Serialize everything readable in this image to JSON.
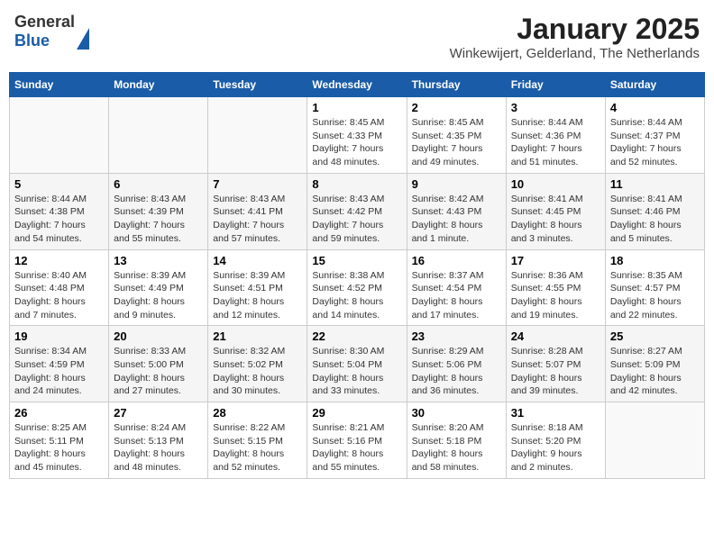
{
  "header": {
    "logo": {
      "line1": "General",
      "line2": "Blue"
    },
    "title": "January 2025",
    "subtitle": "Winkewijert, Gelderland, The Netherlands"
  },
  "days_of_week": [
    "Sunday",
    "Monday",
    "Tuesday",
    "Wednesday",
    "Thursday",
    "Friday",
    "Saturday"
  ],
  "weeks": [
    [
      {
        "day": "",
        "info": ""
      },
      {
        "day": "",
        "info": ""
      },
      {
        "day": "",
        "info": ""
      },
      {
        "day": "1",
        "info": "Sunrise: 8:45 AM\nSunset: 4:33 PM\nDaylight: 7 hours\nand 48 minutes."
      },
      {
        "day": "2",
        "info": "Sunrise: 8:45 AM\nSunset: 4:35 PM\nDaylight: 7 hours\nand 49 minutes."
      },
      {
        "day": "3",
        "info": "Sunrise: 8:44 AM\nSunset: 4:36 PM\nDaylight: 7 hours\nand 51 minutes."
      },
      {
        "day": "4",
        "info": "Sunrise: 8:44 AM\nSunset: 4:37 PM\nDaylight: 7 hours\nand 52 minutes."
      }
    ],
    [
      {
        "day": "5",
        "info": "Sunrise: 8:44 AM\nSunset: 4:38 PM\nDaylight: 7 hours\nand 54 minutes."
      },
      {
        "day": "6",
        "info": "Sunrise: 8:43 AM\nSunset: 4:39 PM\nDaylight: 7 hours\nand 55 minutes."
      },
      {
        "day": "7",
        "info": "Sunrise: 8:43 AM\nSunset: 4:41 PM\nDaylight: 7 hours\nand 57 minutes."
      },
      {
        "day": "8",
        "info": "Sunrise: 8:43 AM\nSunset: 4:42 PM\nDaylight: 7 hours\nand 59 minutes."
      },
      {
        "day": "9",
        "info": "Sunrise: 8:42 AM\nSunset: 4:43 PM\nDaylight: 8 hours\nand 1 minute."
      },
      {
        "day": "10",
        "info": "Sunrise: 8:41 AM\nSunset: 4:45 PM\nDaylight: 8 hours\nand 3 minutes."
      },
      {
        "day": "11",
        "info": "Sunrise: 8:41 AM\nSunset: 4:46 PM\nDaylight: 8 hours\nand 5 minutes."
      }
    ],
    [
      {
        "day": "12",
        "info": "Sunrise: 8:40 AM\nSunset: 4:48 PM\nDaylight: 8 hours\nand 7 minutes."
      },
      {
        "day": "13",
        "info": "Sunrise: 8:39 AM\nSunset: 4:49 PM\nDaylight: 8 hours\nand 9 minutes."
      },
      {
        "day": "14",
        "info": "Sunrise: 8:39 AM\nSunset: 4:51 PM\nDaylight: 8 hours\nand 12 minutes."
      },
      {
        "day": "15",
        "info": "Sunrise: 8:38 AM\nSunset: 4:52 PM\nDaylight: 8 hours\nand 14 minutes."
      },
      {
        "day": "16",
        "info": "Sunrise: 8:37 AM\nSunset: 4:54 PM\nDaylight: 8 hours\nand 17 minutes."
      },
      {
        "day": "17",
        "info": "Sunrise: 8:36 AM\nSunset: 4:55 PM\nDaylight: 8 hours\nand 19 minutes."
      },
      {
        "day": "18",
        "info": "Sunrise: 8:35 AM\nSunset: 4:57 PM\nDaylight: 8 hours\nand 22 minutes."
      }
    ],
    [
      {
        "day": "19",
        "info": "Sunrise: 8:34 AM\nSunset: 4:59 PM\nDaylight: 8 hours\nand 24 minutes."
      },
      {
        "day": "20",
        "info": "Sunrise: 8:33 AM\nSunset: 5:00 PM\nDaylight: 8 hours\nand 27 minutes."
      },
      {
        "day": "21",
        "info": "Sunrise: 8:32 AM\nSunset: 5:02 PM\nDaylight: 8 hours\nand 30 minutes."
      },
      {
        "day": "22",
        "info": "Sunrise: 8:30 AM\nSunset: 5:04 PM\nDaylight: 8 hours\nand 33 minutes."
      },
      {
        "day": "23",
        "info": "Sunrise: 8:29 AM\nSunset: 5:06 PM\nDaylight: 8 hours\nand 36 minutes."
      },
      {
        "day": "24",
        "info": "Sunrise: 8:28 AM\nSunset: 5:07 PM\nDaylight: 8 hours\nand 39 minutes."
      },
      {
        "day": "25",
        "info": "Sunrise: 8:27 AM\nSunset: 5:09 PM\nDaylight: 8 hours\nand 42 minutes."
      }
    ],
    [
      {
        "day": "26",
        "info": "Sunrise: 8:25 AM\nSunset: 5:11 PM\nDaylight: 8 hours\nand 45 minutes."
      },
      {
        "day": "27",
        "info": "Sunrise: 8:24 AM\nSunset: 5:13 PM\nDaylight: 8 hours\nand 48 minutes."
      },
      {
        "day": "28",
        "info": "Sunrise: 8:22 AM\nSunset: 5:15 PM\nDaylight: 8 hours\nand 52 minutes."
      },
      {
        "day": "29",
        "info": "Sunrise: 8:21 AM\nSunset: 5:16 PM\nDaylight: 8 hours\nand 55 minutes."
      },
      {
        "day": "30",
        "info": "Sunrise: 8:20 AM\nSunset: 5:18 PM\nDaylight: 8 hours\nand 58 minutes."
      },
      {
        "day": "31",
        "info": "Sunrise: 8:18 AM\nSunset: 5:20 PM\nDaylight: 9 hours\nand 2 minutes."
      },
      {
        "day": "",
        "info": ""
      }
    ]
  ]
}
